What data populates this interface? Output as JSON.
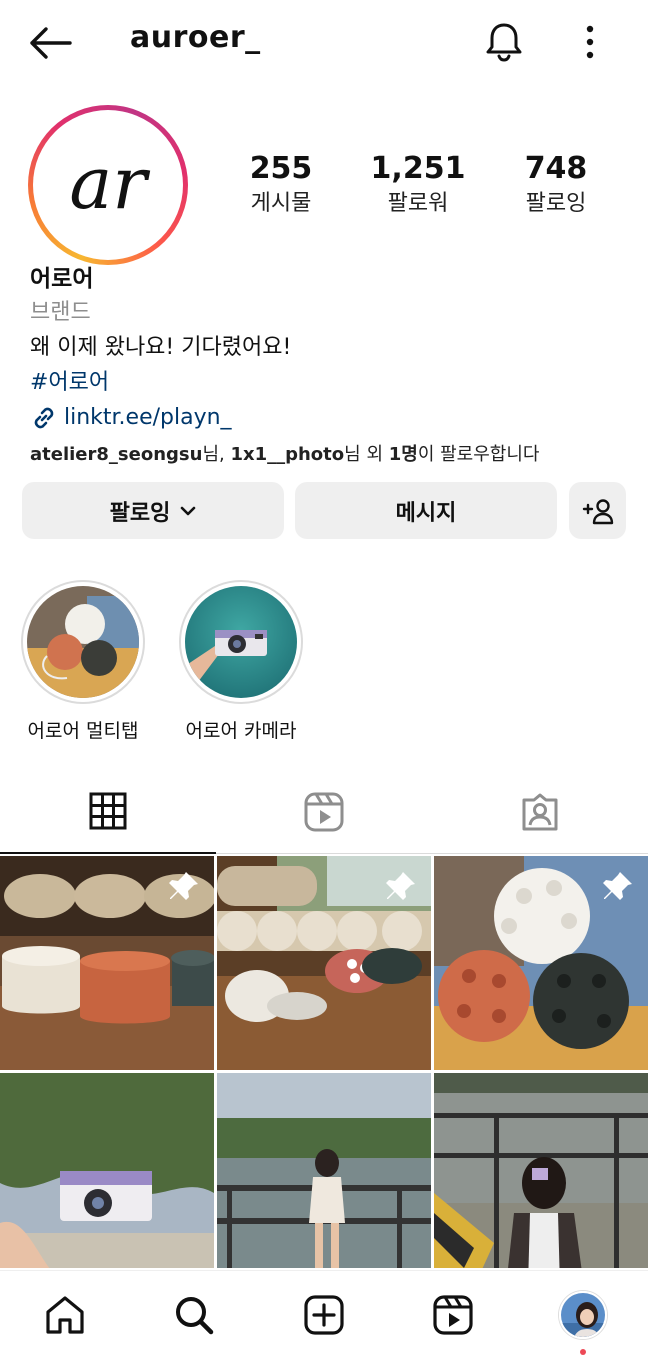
{
  "header": {
    "username": "auroer_"
  },
  "profile": {
    "avatar_logo": "ar",
    "stats": [
      {
        "value": "255",
        "label": "게시물"
      },
      {
        "value": "1,251",
        "label": "팔로워"
      },
      {
        "value": "748",
        "label": "팔로잉"
      }
    ],
    "name": "어로어",
    "category": "브랜드",
    "tagline": "왜 이제 왔나요! 기다렸어요!",
    "hashtag": "#어로어",
    "link": "linktr.ee/playn_",
    "followed_by": {
      "user1": "atelier8_seongsu",
      "suffix1": "님, ",
      "user2": "1x1__photo",
      "suffix2": "님 외 ",
      "count": "1명",
      "suffix3": "이 팔로우합니다"
    }
  },
  "actions": {
    "follow_label": "팔로잉",
    "message_label": "메시지",
    "add_user_label": "+"
  },
  "highlights": [
    {
      "label": "어로어 멀티탭"
    },
    {
      "label": "어로어 카메라"
    }
  ],
  "tabs": [
    {
      "icon": "grid-icon",
      "active": true
    },
    {
      "icon": "reels-icon",
      "active": false
    },
    {
      "icon": "tagged-icon",
      "active": false
    }
  ],
  "posts": [
    {
      "pinned": true
    },
    {
      "pinned": true
    },
    {
      "pinned": true
    },
    {
      "pinned": false
    },
    {
      "pinned": false
    },
    {
      "pinned": false
    }
  ],
  "nav": [
    "home-icon",
    "search-icon",
    "create-icon",
    "reels-icon",
    "profile-avatar"
  ],
  "colors": {
    "link": "#00376b",
    "button_bg": "#efefef",
    "notification_dot": "#ed4956"
  }
}
